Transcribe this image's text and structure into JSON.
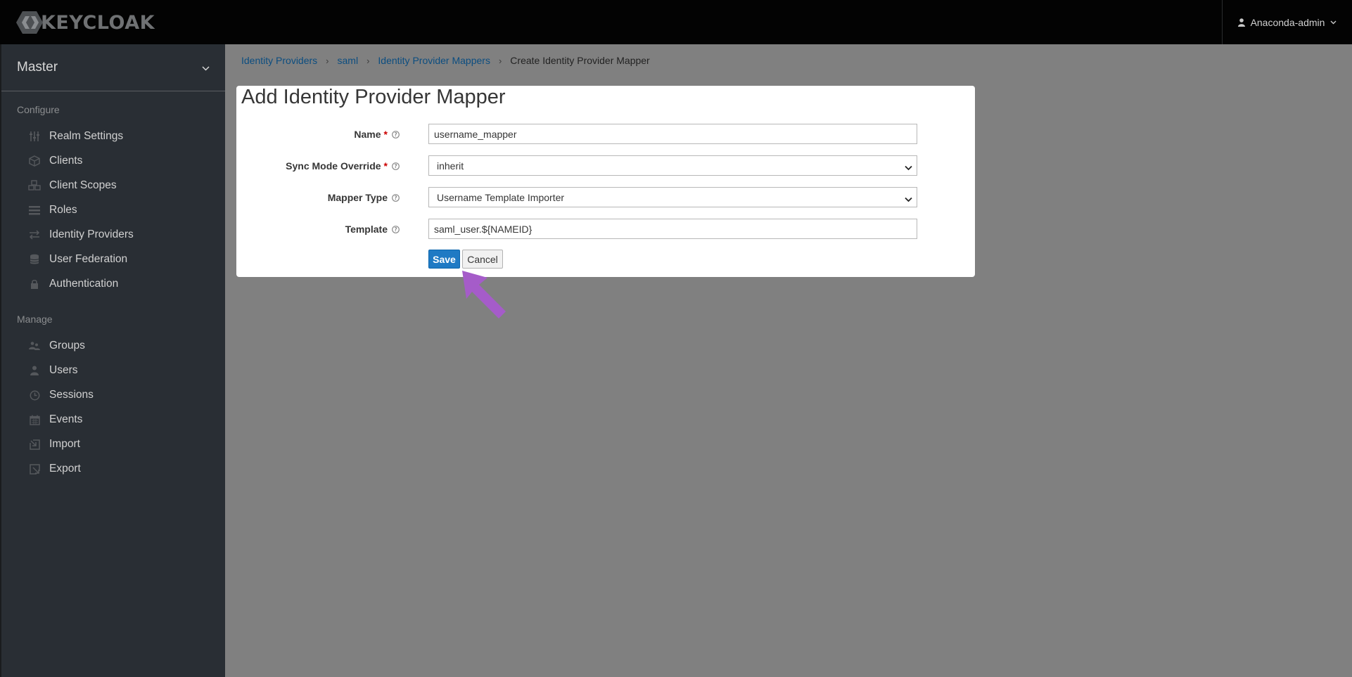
{
  "header": {
    "logo_text": "KEYCLOAK",
    "user_name": "Anaconda-admin"
  },
  "sidebar": {
    "realm": "Master",
    "configure_title": "Configure",
    "configure_items": [
      {
        "label": "Realm Settings",
        "icon": "sliders-icon"
      },
      {
        "label": "Clients",
        "icon": "cube-icon"
      },
      {
        "label": "Client Scopes",
        "icon": "cubes-icon"
      },
      {
        "label": "Roles",
        "icon": "list-icon"
      },
      {
        "label": "Identity Providers",
        "icon": "exchange-icon"
      },
      {
        "label": "User Federation",
        "icon": "database-icon"
      },
      {
        "label": "Authentication",
        "icon": "lock-icon"
      }
    ],
    "manage_title": "Manage",
    "manage_items": [
      {
        "label": "Groups",
        "icon": "group-icon"
      },
      {
        "label": "Users",
        "icon": "user-icon"
      },
      {
        "label": "Sessions",
        "icon": "clock-icon"
      },
      {
        "label": "Events",
        "icon": "calendar-icon"
      },
      {
        "label": "Import",
        "icon": "import-icon"
      },
      {
        "label": "Export",
        "icon": "export-icon"
      }
    ]
  },
  "breadcrumb": {
    "items": [
      "Identity Providers",
      "saml",
      "Identity Provider Mappers"
    ],
    "current": "Create Identity Provider Mapper"
  },
  "form": {
    "title": "Add Identity Provider Mapper",
    "name_label": "Name",
    "name_value": "username_mapper",
    "sync_label": "Sync Mode Override",
    "sync_value": "inherit",
    "mapper_label": "Mapper Type",
    "mapper_value": "Username Template Importer",
    "template_label": "Template",
    "template_value": "saml_user.${NAMEID}",
    "required_marker": "*",
    "save_label": "Save",
    "cancel_label": "Cancel"
  },
  "colors": {
    "header_bg": "#030303",
    "sidebar_bg": "#292e34",
    "main_bg": "#808080",
    "link": "#0b4d80",
    "primary": "#1f7ac4",
    "arrow": "#a55cc9"
  }
}
